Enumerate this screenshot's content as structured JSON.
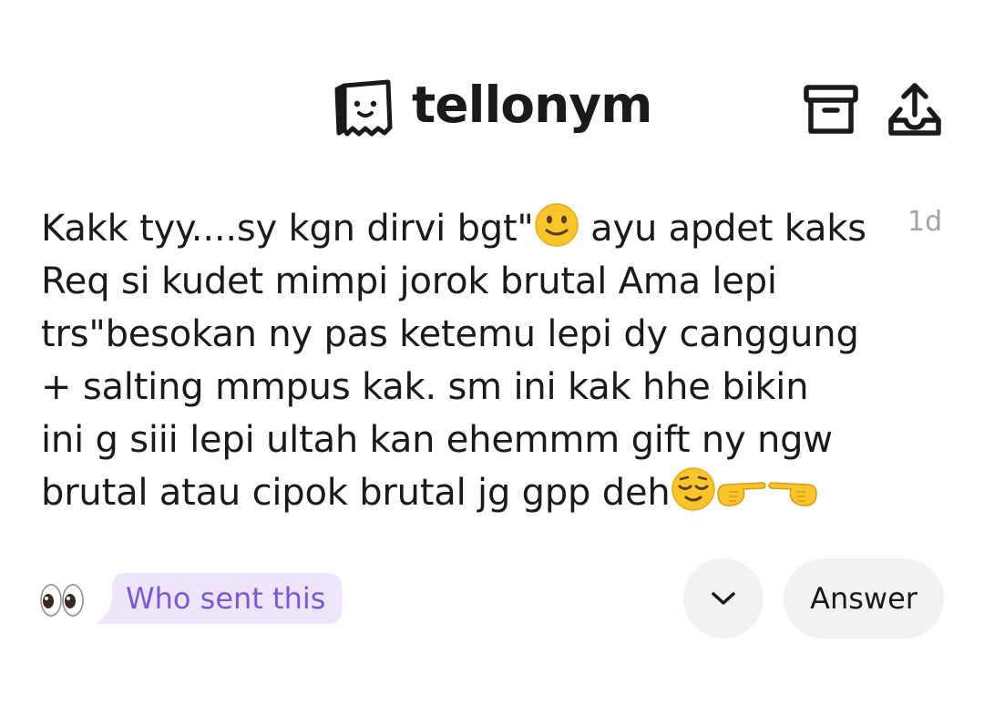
{
  "header": {
    "brand": "tellonym",
    "icons": [
      "tellonym-logo-icon",
      "archive-icon",
      "share-icon"
    ]
  },
  "message": {
    "lines": [
      "Kakk tyy....sy kgn dirvi bgt\"",
      " ayu apdet kaks",
      "Req si kudet mimpi jorok brutal Ama lepi",
      "trs\"besokan ny pas ketemu lepi dy canggung",
      "+ salting mmpus kak. sm ini kak hhe bikin",
      "ini g siii lepi ultah kan ehemmm gift ny ngw",
      "brutal atau cipok brutal jg gpp deh"
    ],
    "emojis": [
      "slightly-smiling-face",
      "relieved-face",
      "backhand-pointing-right",
      "backhand-pointing-left"
    ],
    "time": "1d"
  },
  "actions": {
    "who_sent_label": "Who sent this",
    "answer_label": "Answer",
    "icons": [
      "eyes-icon",
      "chevron-down-icon"
    ]
  },
  "colors": {
    "bubble_bg": "#ede5fb",
    "bubble_text": "#7c5ad6",
    "button_bg": "#f2f2f4",
    "timestamp": "#a3a3a3"
  }
}
